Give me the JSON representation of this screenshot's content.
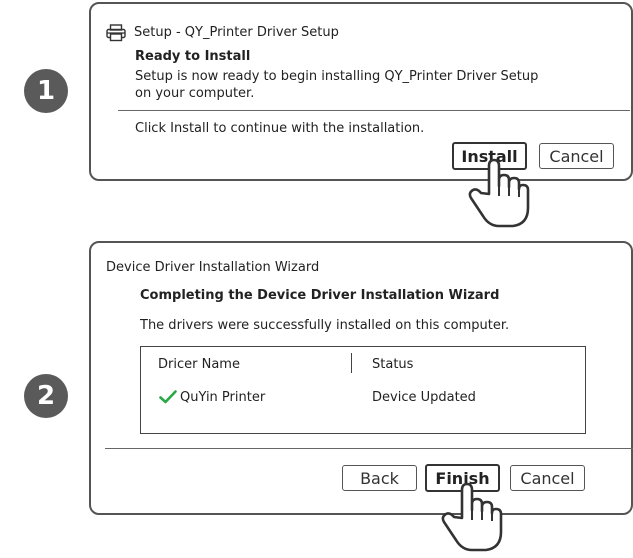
{
  "step1": {
    "number": "1",
    "window_title": "Setup - QY_Printer Driver Setup",
    "heading": "Ready to Install",
    "desc_line1": "Setup is now ready to begin installing QY_Printer Driver Setup",
    "desc_line2": "on your computer.",
    "instruction": "Click Install to continue with the installation.",
    "install_label": "Install",
    "cancel_label": "Cancel"
  },
  "step2": {
    "number": "2",
    "window_title": "Device Driver Installation Wizard",
    "heading": "Completing the Device Driver Installation Wizard",
    "desc": "The drivers were successfully installed on this computer.",
    "columns": [
      "Dricer Name",
      "Status"
    ],
    "rows": [
      {
        "name": "QuYin Printer",
        "status": "Device Updated"
      }
    ],
    "back_label": "Back",
    "finish_label": "Finish",
    "cancel_label": "Cancel"
  },
  "colors": {
    "check_green": "#2aa845",
    "step_circle": "#5a5a5a",
    "border": "#555555"
  },
  "icons": [
    "printer-icon",
    "checkmark-icon",
    "hand-pointer-icon"
  ]
}
